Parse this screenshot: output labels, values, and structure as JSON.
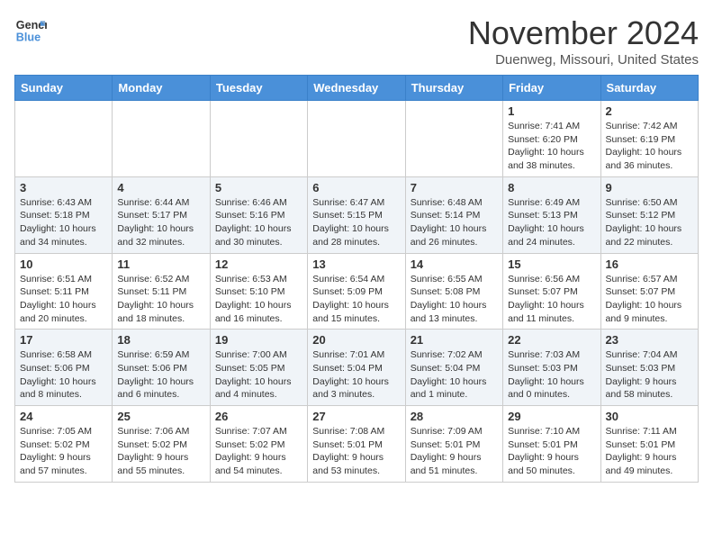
{
  "logo": {
    "line1": "General",
    "line2": "Blue"
  },
  "title": "November 2024",
  "location": "Duenweg, Missouri, United States",
  "weekdays": [
    "Sunday",
    "Monday",
    "Tuesday",
    "Wednesday",
    "Thursday",
    "Friday",
    "Saturday"
  ],
  "weeks": [
    [
      {
        "day": "",
        "info": ""
      },
      {
        "day": "",
        "info": ""
      },
      {
        "day": "",
        "info": ""
      },
      {
        "day": "",
        "info": ""
      },
      {
        "day": "",
        "info": ""
      },
      {
        "day": "1",
        "info": "Sunrise: 7:41 AM\nSunset: 6:20 PM\nDaylight: 10 hours and 38 minutes."
      },
      {
        "day": "2",
        "info": "Sunrise: 7:42 AM\nSunset: 6:19 PM\nDaylight: 10 hours and 36 minutes."
      }
    ],
    [
      {
        "day": "3",
        "info": "Sunrise: 6:43 AM\nSunset: 5:18 PM\nDaylight: 10 hours and 34 minutes."
      },
      {
        "day": "4",
        "info": "Sunrise: 6:44 AM\nSunset: 5:17 PM\nDaylight: 10 hours and 32 minutes."
      },
      {
        "day": "5",
        "info": "Sunrise: 6:46 AM\nSunset: 5:16 PM\nDaylight: 10 hours and 30 minutes."
      },
      {
        "day": "6",
        "info": "Sunrise: 6:47 AM\nSunset: 5:15 PM\nDaylight: 10 hours and 28 minutes."
      },
      {
        "day": "7",
        "info": "Sunrise: 6:48 AM\nSunset: 5:14 PM\nDaylight: 10 hours and 26 minutes."
      },
      {
        "day": "8",
        "info": "Sunrise: 6:49 AM\nSunset: 5:13 PM\nDaylight: 10 hours and 24 minutes."
      },
      {
        "day": "9",
        "info": "Sunrise: 6:50 AM\nSunset: 5:12 PM\nDaylight: 10 hours and 22 minutes."
      }
    ],
    [
      {
        "day": "10",
        "info": "Sunrise: 6:51 AM\nSunset: 5:11 PM\nDaylight: 10 hours and 20 minutes."
      },
      {
        "day": "11",
        "info": "Sunrise: 6:52 AM\nSunset: 5:11 PM\nDaylight: 10 hours and 18 minutes."
      },
      {
        "day": "12",
        "info": "Sunrise: 6:53 AM\nSunset: 5:10 PM\nDaylight: 10 hours and 16 minutes."
      },
      {
        "day": "13",
        "info": "Sunrise: 6:54 AM\nSunset: 5:09 PM\nDaylight: 10 hours and 15 minutes."
      },
      {
        "day": "14",
        "info": "Sunrise: 6:55 AM\nSunset: 5:08 PM\nDaylight: 10 hours and 13 minutes."
      },
      {
        "day": "15",
        "info": "Sunrise: 6:56 AM\nSunset: 5:07 PM\nDaylight: 10 hours and 11 minutes."
      },
      {
        "day": "16",
        "info": "Sunrise: 6:57 AM\nSunset: 5:07 PM\nDaylight: 10 hours and 9 minutes."
      }
    ],
    [
      {
        "day": "17",
        "info": "Sunrise: 6:58 AM\nSunset: 5:06 PM\nDaylight: 10 hours and 8 minutes."
      },
      {
        "day": "18",
        "info": "Sunrise: 6:59 AM\nSunset: 5:06 PM\nDaylight: 10 hours and 6 minutes."
      },
      {
        "day": "19",
        "info": "Sunrise: 7:00 AM\nSunset: 5:05 PM\nDaylight: 10 hours and 4 minutes."
      },
      {
        "day": "20",
        "info": "Sunrise: 7:01 AM\nSunset: 5:04 PM\nDaylight: 10 hours and 3 minutes."
      },
      {
        "day": "21",
        "info": "Sunrise: 7:02 AM\nSunset: 5:04 PM\nDaylight: 10 hours and 1 minute."
      },
      {
        "day": "22",
        "info": "Sunrise: 7:03 AM\nSunset: 5:03 PM\nDaylight: 10 hours and 0 minutes."
      },
      {
        "day": "23",
        "info": "Sunrise: 7:04 AM\nSunset: 5:03 PM\nDaylight: 9 hours and 58 minutes."
      }
    ],
    [
      {
        "day": "24",
        "info": "Sunrise: 7:05 AM\nSunset: 5:02 PM\nDaylight: 9 hours and 57 minutes."
      },
      {
        "day": "25",
        "info": "Sunrise: 7:06 AM\nSunset: 5:02 PM\nDaylight: 9 hours and 55 minutes."
      },
      {
        "day": "26",
        "info": "Sunrise: 7:07 AM\nSunset: 5:02 PM\nDaylight: 9 hours and 54 minutes."
      },
      {
        "day": "27",
        "info": "Sunrise: 7:08 AM\nSunset: 5:01 PM\nDaylight: 9 hours and 53 minutes."
      },
      {
        "day": "28",
        "info": "Sunrise: 7:09 AM\nSunset: 5:01 PM\nDaylight: 9 hours and 51 minutes."
      },
      {
        "day": "29",
        "info": "Sunrise: 7:10 AM\nSunset: 5:01 PM\nDaylight: 9 hours and 50 minutes."
      },
      {
        "day": "30",
        "info": "Sunrise: 7:11 AM\nSunset: 5:01 PM\nDaylight: 9 hours and 49 minutes."
      }
    ]
  ]
}
